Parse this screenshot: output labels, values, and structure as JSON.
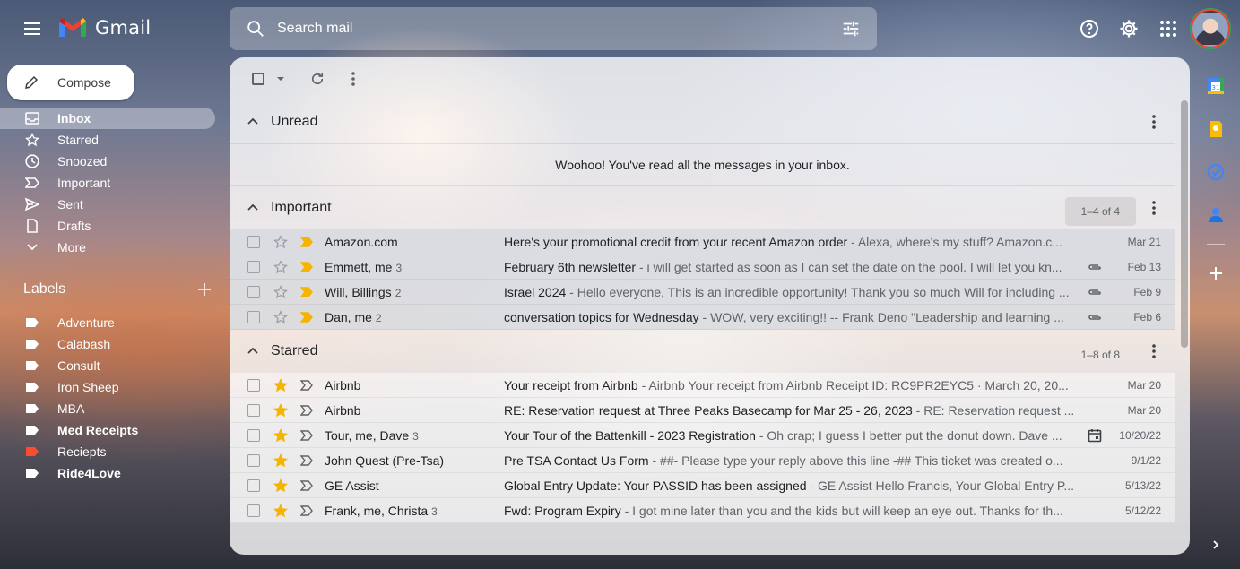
{
  "app": {
    "name": "Gmail",
    "colors": {
      "logo_red": "#EA4335",
      "logo_blue": "#4285F4",
      "logo_green": "#34A853",
      "logo_yellow": "#FBBC04",
      "important_marker": "#F4B400",
      "star": "#F4B400"
    }
  },
  "search": {
    "placeholder": "Search mail",
    "icon": "search-icon",
    "options_icon": "tune-icon"
  },
  "header_icons": [
    "help-icon",
    "settings-icon",
    "apps-icon",
    "account-avatar"
  ],
  "compose": {
    "label": "Compose",
    "icon": "pencil-icon"
  },
  "nav": {
    "items": [
      {
        "label": "Inbox",
        "icon": "inbox-icon",
        "active": true
      },
      {
        "label": "Starred",
        "icon": "star-outline-icon"
      },
      {
        "label": "Snoozed",
        "icon": "clock-icon"
      },
      {
        "label": "Important",
        "icon": "important-icon"
      },
      {
        "label": "Sent",
        "icon": "send-icon"
      },
      {
        "label": "Drafts",
        "icon": "draft-icon"
      },
      {
        "label": "More",
        "icon": "chevron-down-icon"
      }
    ]
  },
  "labels": {
    "title": "Labels",
    "items": [
      {
        "label": "Adventure",
        "color": "#ffffff"
      },
      {
        "label": "Calabash",
        "color": "#ffffff"
      },
      {
        "label": "Consult",
        "color": "#ffffff"
      },
      {
        "label": "Iron Sheep",
        "color": "#ffffff"
      },
      {
        "label": "MBA",
        "color": "#ffffff"
      },
      {
        "label": "Med Receipts",
        "color": "#ffffff",
        "bold": true
      },
      {
        "label": "Reciepts",
        "color": "#fb4c2f"
      },
      {
        "label": "Ride4Love",
        "color": "#ffffff",
        "bold": true
      }
    ]
  },
  "sections": {
    "unread": {
      "title": "Unread",
      "empty_message": "Woohoo! You've read all the messages in your inbox."
    },
    "important": {
      "title": "Important",
      "count": "1–4 of 4",
      "rows": [
        {
          "sender": "Amazon.com",
          "count": "",
          "subject": "Here's your promotional credit from your recent Amazon order",
          "snippet": "Alexa, where's my stuff? Amazon.c...",
          "attachment": false,
          "date": "Mar 21"
        },
        {
          "sender": "Emmett, me",
          "count": "3",
          "subject": "February 6th newsletter",
          "snippet": "i will get started as soon as I can set the date on the pool. I will let you kn...",
          "attachment": true,
          "date": "Feb 13"
        },
        {
          "sender": "Will, Billings",
          "count": "2",
          "subject": "Israel 2024",
          "snippet": "Hello everyone, This is an incredible opportunity! Thank you so much Will for including ...",
          "attachment": true,
          "date": "Feb 9"
        },
        {
          "sender": "Dan, me",
          "count": "2",
          "subject": "conversation topics for Wednesday",
          "snippet": "WOW, very exciting!! -- Frank Deno \"Leadership and learning ...",
          "attachment": true,
          "date": "Feb 6"
        }
      ]
    },
    "starred": {
      "title": "Starred",
      "count": "1–8 of 8",
      "rows": [
        {
          "sender": "Airbnb",
          "count": "",
          "subject": "Your receipt from Airbnb",
          "snippet": "Airbnb Your receipt from Airbnb Receipt ID: RC9PR2EYC5 · March 20, 20...",
          "attachment": false,
          "date": "Mar 20"
        },
        {
          "sender": "Airbnb",
          "count": "",
          "subject": "RE: Reservation request at Three Peaks Basecamp for Mar 25 - 26, 2023",
          "snippet": "RE: Reservation request ...",
          "attachment": false,
          "date": "Mar 20"
        },
        {
          "sender": "Tour, me, Dave",
          "count": "3",
          "subject": "Your Tour of the Battenkill - 2023 Registration",
          "snippet": "Oh crap; I guess I better put the donut down. Dave ...",
          "calendar": true,
          "date": "10/20/22"
        },
        {
          "sender": "John Quest (Pre-Tsa)",
          "count": "",
          "subject": "Pre TSA Contact Us Form",
          "snippet": "##- Please type your reply above this line -## This ticket was created o...",
          "attachment": false,
          "date": "9/1/22"
        },
        {
          "sender": "GE Assist",
          "count": "",
          "subject": "Global Entry Update: Your PASSID has been assigned",
          "snippet": "GE Assist Hello Francis, Your Global Entry P...",
          "attachment": false,
          "date": "5/13/22"
        },
        {
          "sender": "Frank, me, Christa",
          "count": "3",
          "subject": "Fwd: Program Expiry",
          "snippet": "I got mine later than you and the kids but will keep an eye out. Thanks for th...",
          "attachment": false,
          "date": "5/12/22"
        }
      ]
    }
  },
  "side_panel": [
    "calendar-icon",
    "keep-icon",
    "tasks-icon",
    "contacts-icon",
    "add-icon"
  ]
}
